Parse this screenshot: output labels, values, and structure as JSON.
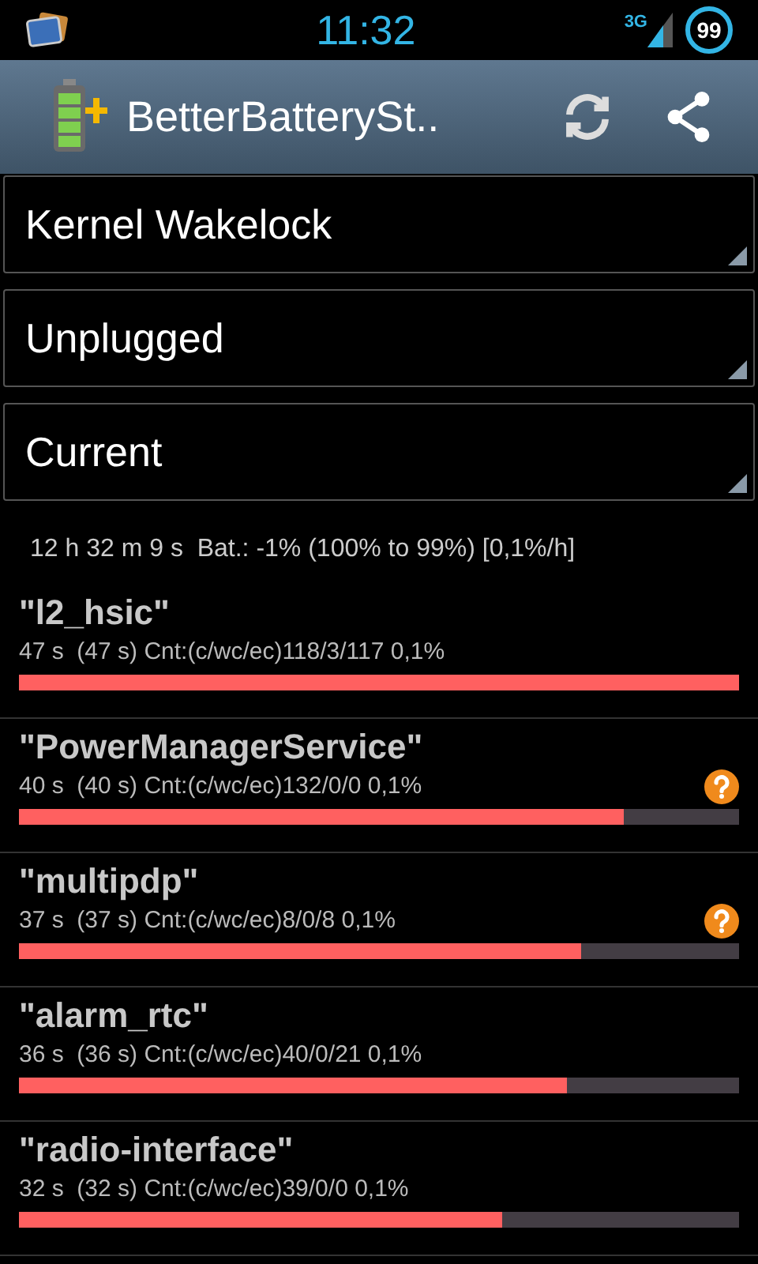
{
  "status_bar": {
    "time": "11:32",
    "network": "3G",
    "battery": "99"
  },
  "action_bar": {
    "title": "BetterBatterySt.."
  },
  "spinners": [
    {
      "value": "Kernel Wakelock"
    },
    {
      "value": "Unplugged"
    },
    {
      "value": "Current"
    }
  ],
  "summary": "12 h 32 m 9 s  Bat.: -1% (100% to 99%) [0,1%/h]",
  "entries": [
    {
      "name": "\"l2_hsic\"",
      "details": "47 s  (47 s) Cnt:(c/wc/ec)118/3/117 0,1%",
      "level": 1.0,
      "help": false
    },
    {
      "name": "\"PowerManagerService\"",
      "details": "40 s  (40 s) Cnt:(c/wc/ec)132/0/0 0,1%",
      "level": 0.84,
      "help": true
    },
    {
      "name": "\"multipdp\"",
      "details": "37 s  (37 s) Cnt:(c/wc/ec)8/0/8 0,1%",
      "level": 0.78,
      "help": true
    },
    {
      "name": "\"alarm_rtc\"",
      "details": "36 s  (36 s) Cnt:(c/wc/ec)40/0/21 0,1%",
      "level": 0.76,
      "help": false
    },
    {
      "name": "\"radio-interface\"",
      "details": "32 s  (32 s) Cnt:(c/wc/ec)39/0/0 0,1%",
      "level": 0.67,
      "help": false
    }
  ]
}
